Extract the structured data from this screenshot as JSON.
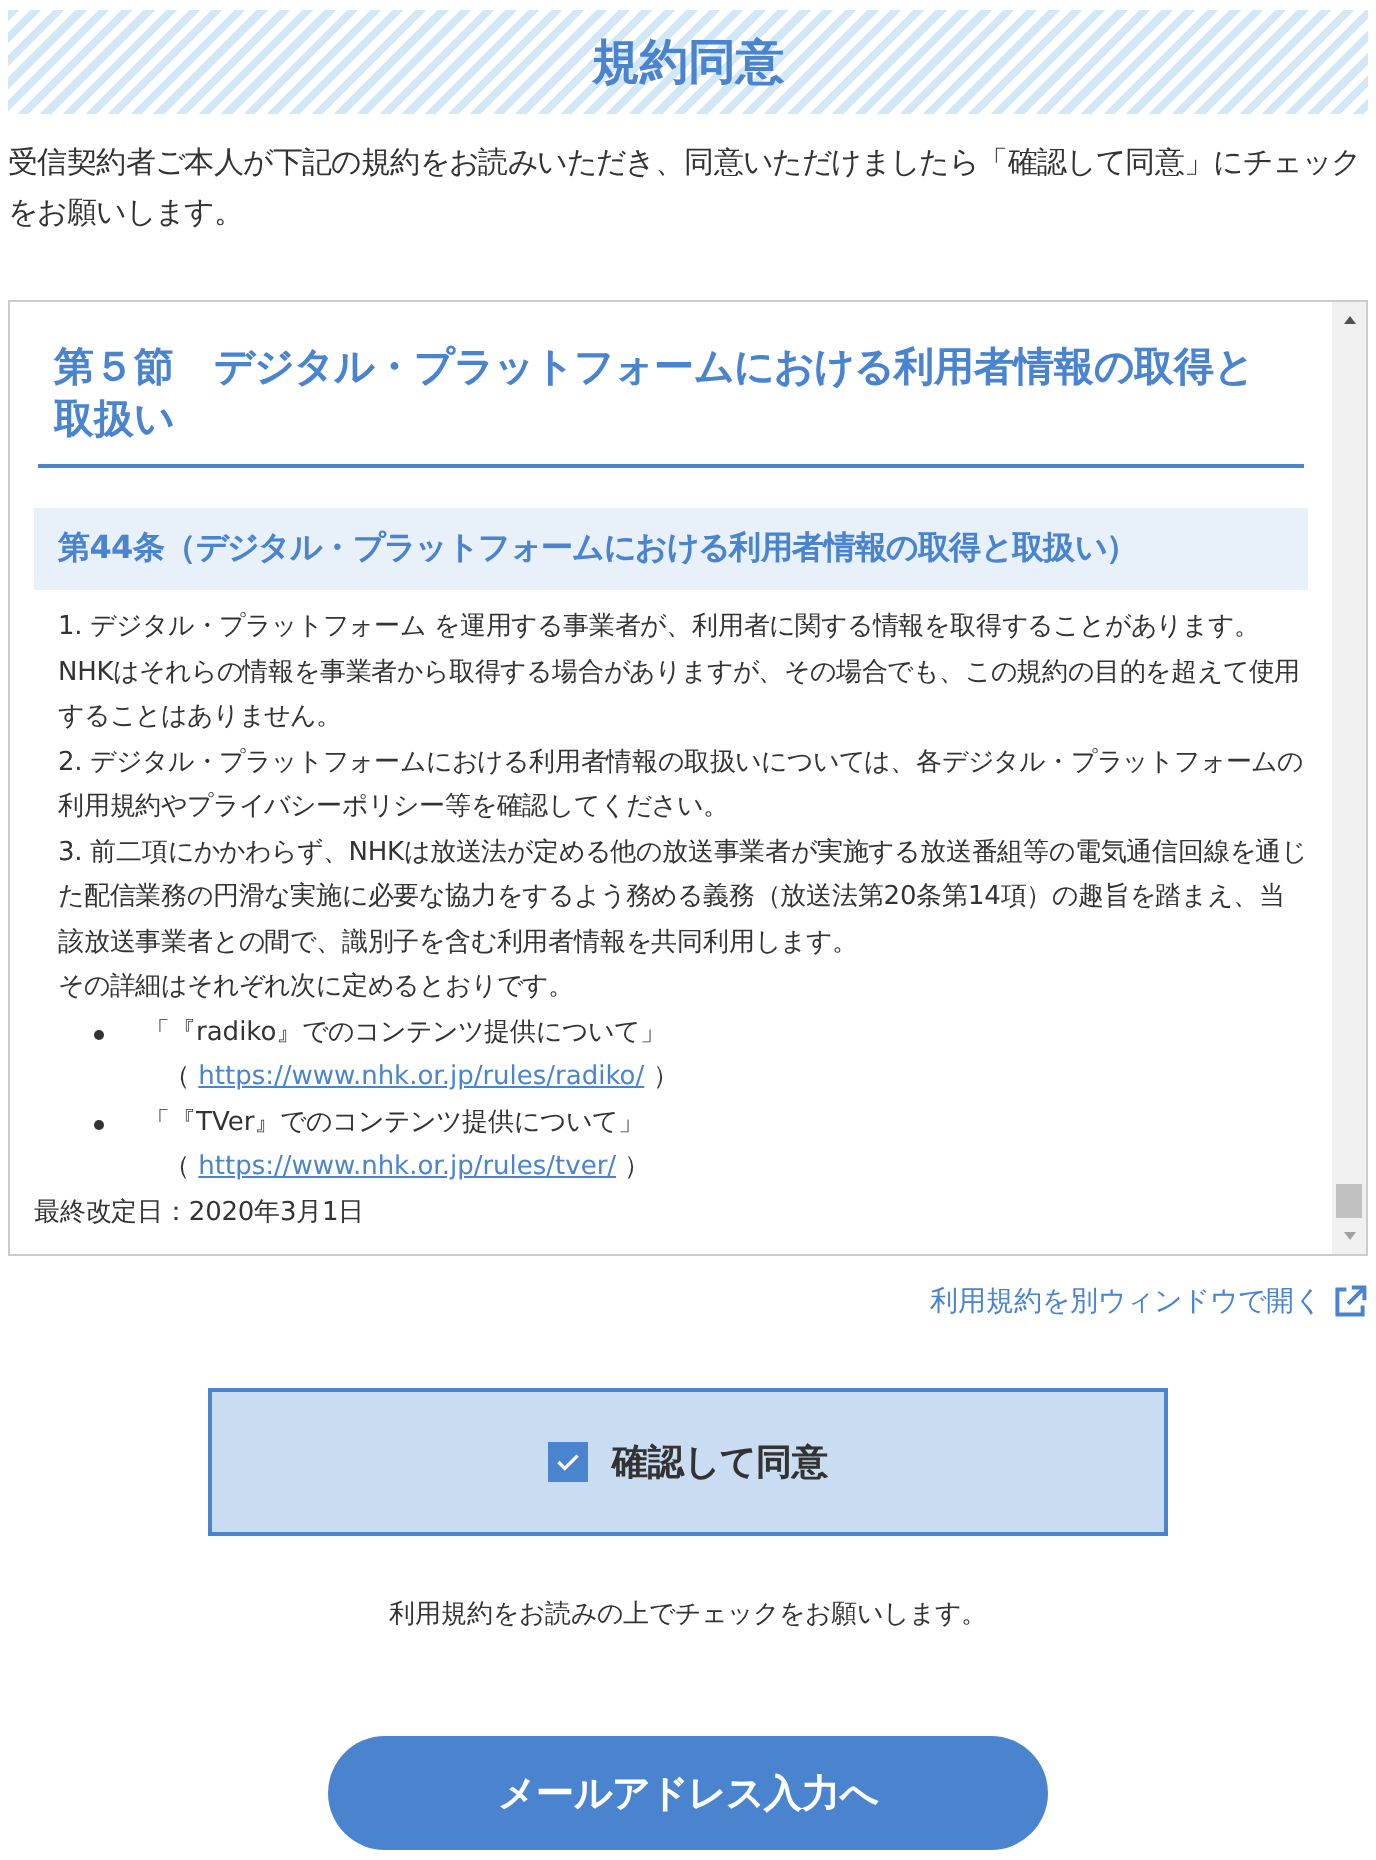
{
  "title": "規約同意",
  "intro": "受信契約者ご本人が下記の規約をお読みいただき、同意いただけましたら「確認して同意」にチェックをお願いします。",
  "terms": {
    "section_heading": "第５節　デジタル・プラットフォームにおける利用者情報の取得と取扱い",
    "article_heading": "第44条（デジタル・プラットフォームにおける利用者情報の取得と取扱い）",
    "paragraphs": [
      "1. デジタル・プラットフォーム を運用する事業者が、利用者に関する情報を取得することがあります。NHKはそれらの情報を事業者から取得する場合がありますが、その場合でも、この規約の目的を超えて使用することはありません。",
      "2. デジタル・プラットフォームにおける利用者情報の取扱いについては、各デジタル・プラットフォームの利用規約やプライバシーポリシー等を確認してください。",
      "3. 前二項にかかわらず、NHKは放送法が定める他の放送事業者が実施する放送番組等の電気通信回線を通じた配信業務の円滑な実施に必要な協力をするよう務める義務（放送法第20条第14項）の趣旨を踏まえ、当該放送事業者との間で、識別子を含む利用者情報を共同利用します。",
      "その詳細はそれぞれ次に定めるとおりです。"
    ],
    "links": [
      {
        "title": "「『radiko』でのコンテンツ提供について」",
        "open": "（",
        "url": "https://www.nhk.or.jp/rules/radiko/",
        "close": "）"
      },
      {
        "title": "「『TVer』でのコンテンツ提供について」",
        "open": "（",
        "url": "https://www.nhk.or.jp/rules/tver/",
        "close": "）"
      }
    ],
    "revised": "最終改定日：2020年3月1日"
  },
  "open_link": "利用規約を別ウィンドウで開く",
  "agree": {
    "label": "確認して同意",
    "checked": true
  },
  "note": "利用規約をお読みの上でチェックをお願いします。",
  "next_button": "メールアドレス入力へ"
}
